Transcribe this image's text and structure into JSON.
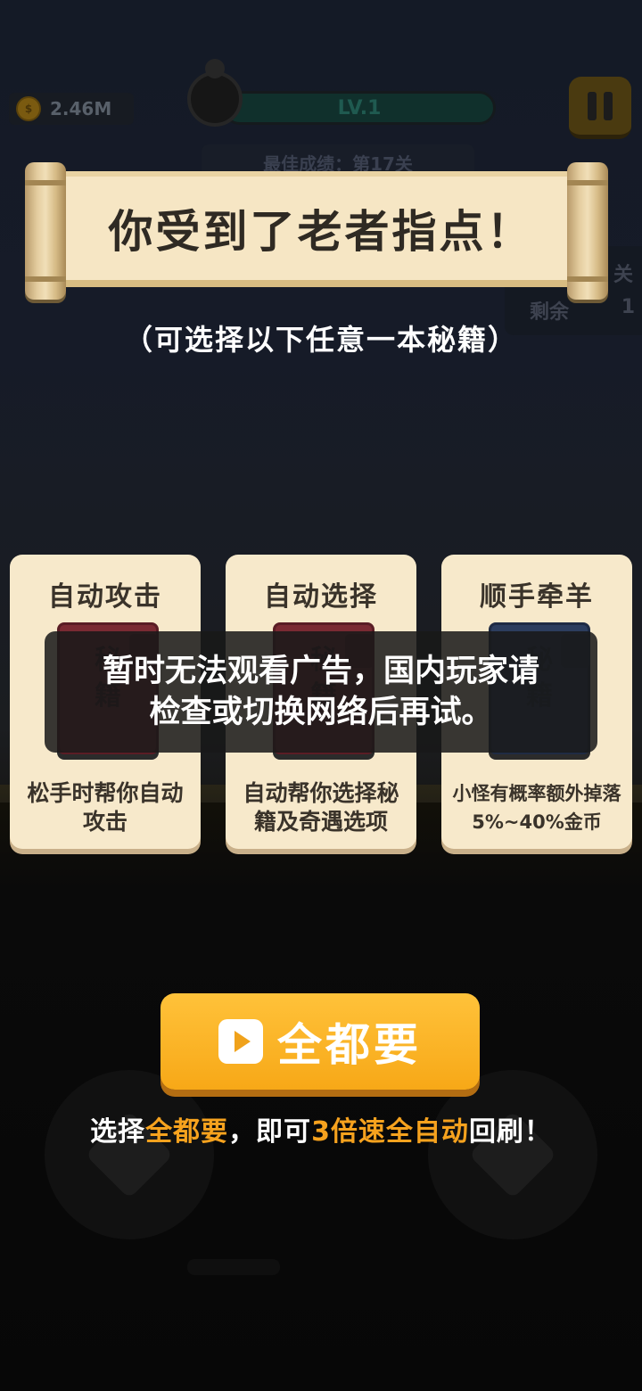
{
  "hud": {
    "coins": "2.46M",
    "level": "LV.1",
    "best_score": "最佳成绩：第17关",
    "side_line1": "关",
    "side_line2": "剩余",
    "side_count": "1"
  },
  "banner": {
    "title": "你受到了老者指点！",
    "subtitle": "（可选择以下任意一本秘籍）"
  },
  "cards": [
    {
      "title": "自动攻击",
      "book_char_top": "秘",
      "book_char_bottom": "籍",
      "book_color": "red",
      "desc": "松手时帮你自动攻击"
    },
    {
      "title": "自动选择",
      "book_char_top": "秘",
      "book_char_bottom": "籍",
      "book_color": "red",
      "desc": "自动帮你选择秘籍及奇遇选项"
    },
    {
      "title": "顺手牵羊",
      "book_char_top": "秘",
      "book_char_bottom": "籍",
      "book_color": "blue",
      "desc": "小怪有概率额外掉落5%~40%金币"
    }
  ],
  "toast": {
    "line1": "暂时无法观看广告，国内玩家请",
    "line2": "检查或切换网络后再试。"
  },
  "all_button": {
    "label": "全都要",
    "icon": "play-icon"
  },
  "tip": {
    "part1": "选择",
    "part2": "全都要",
    "part3": "，即可",
    "part4": "3倍速全自动",
    "part5": "回刷！"
  },
  "colors": {
    "accent": "#f7a817",
    "highlight": "#f6a21e",
    "card_bg": "#f7e9cb"
  }
}
